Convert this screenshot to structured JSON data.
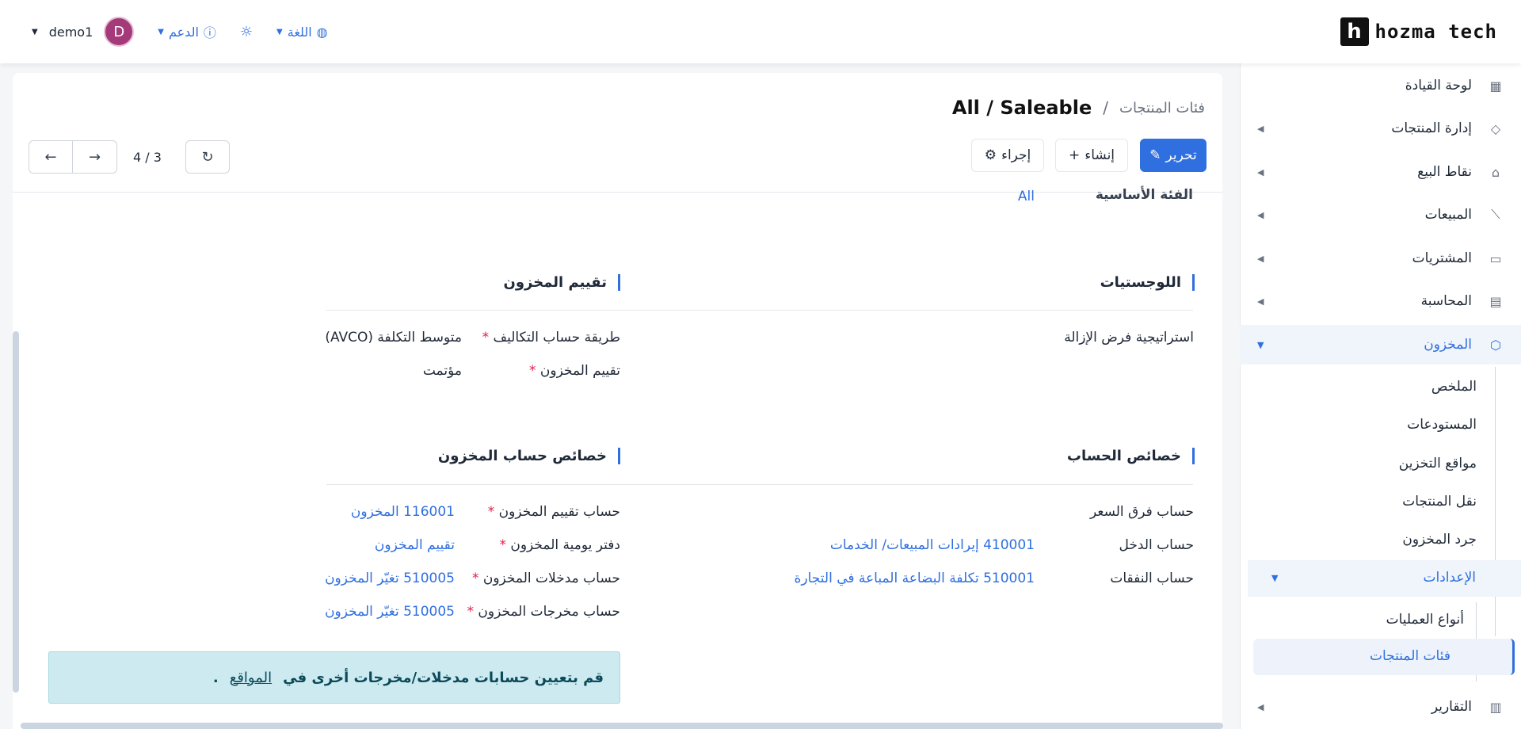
{
  "brand": {
    "logo_mark": "h",
    "name": "hozma tech"
  },
  "topbar": {
    "user_initial": "D",
    "username": "demo1",
    "support_label": "الدعم",
    "language_label": "اللغة",
    "icons": [
      "user-caret",
      "help-circle-icon",
      "sun-icon",
      "globe-icon"
    ]
  },
  "sidebar": {
    "items": [
      {
        "label": "لوحة القيادة",
        "icon": "dashboard-icon"
      },
      {
        "label": "إدارة المنتجات",
        "icon": "tag-icon"
      },
      {
        "label": "نقاط البيع",
        "icon": "store-icon"
      },
      {
        "label": "المبيعات",
        "icon": "chart-line-icon"
      },
      {
        "label": "المشتريات",
        "icon": "wallet-icon"
      },
      {
        "label": "المحاسبة",
        "icon": "receipt-icon"
      },
      {
        "label": "المخزون",
        "icon": "box-icon"
      }
    ],
    "inventory_sub": [
      "الملخص",
      "المستودعات",
      "مواقع التخزين",
      "نقل المنتجات",
      "جرد المخزون"
    ],
    "settings_label": "الإعدادات",
    "settings_sub": [
      "أنواع العمليات",
      "فئات المنتجات"
    ],
    "reports_label": "التقارير"
  },
  "header": {
    "breadcrumb_parent": "فئات المنتجات",
    "breadcrumb_sep": "/",
    "breadcrumb_current": "All / Saleable",
    "edit_label": "تحرير",
    "create_label": "إنشاء",
    "action_label": "إجراء",
    "pager": "4 / 3"
  },
  "form": {
    "parent_label": "الفئة الأساسية",
    "parent_value": "All",
    "logistics_title": "اللوجستيات",
    "removal_strategy_label": "استراتيجية فرض الإزالة",
    "valuation_title": "تقييم المخزون",
    "costing_method_label": "طريقة حساب التكاليف",
    "costing_method_value": "متوسط التكلفة (AVCO)",
    "valuation_label": "تقييم المخزون",
    "valuation_value": "مؤتمت",
    "account_props_title": "خصائص الحساب",
    "price_diff_label": "حساب فرق السعر",
    "income_label": "حساب الدخل",
    "income_value": "410001 إيرادات المبيعات/ الخدمات",
    "expense_label": "حساب النفقات",
    "expense_value": "510001 تكلفة البضاعة المباعة في التجارة",
    "stock_props_title": "خصائص حساب المخزون",
    "stock_valuation_account_label": "حساب تقييم المخزون",
    "stock_valuation_account_value": "116001 المخزون",
    "stock_journal_label": "دفتر يومية المخزون",
    "stock_journal_value": "تقييم المخزون",
    "stock_input_label": "حساب مدخلات المخزون",
    "stock_input_value": "510005 تغيّر المخزون",
    "stock_output_label": "حساب مخرجات المخزون",
    "stock_output_value": "510005 تغيّر المخزون",
    "required_mark": "*"
  },
  "alert": {
    "text": "قم بتعيين حسابات مدخلات/مخرجات أخرى في",
    "link": "المواقع",
    "tail": "."
  },
  "colors": {
    "accent": "#2f6fdf",
    "avatar": "#a53a7a",
    "alert_bg": "#cdeaf0"
  }
}
